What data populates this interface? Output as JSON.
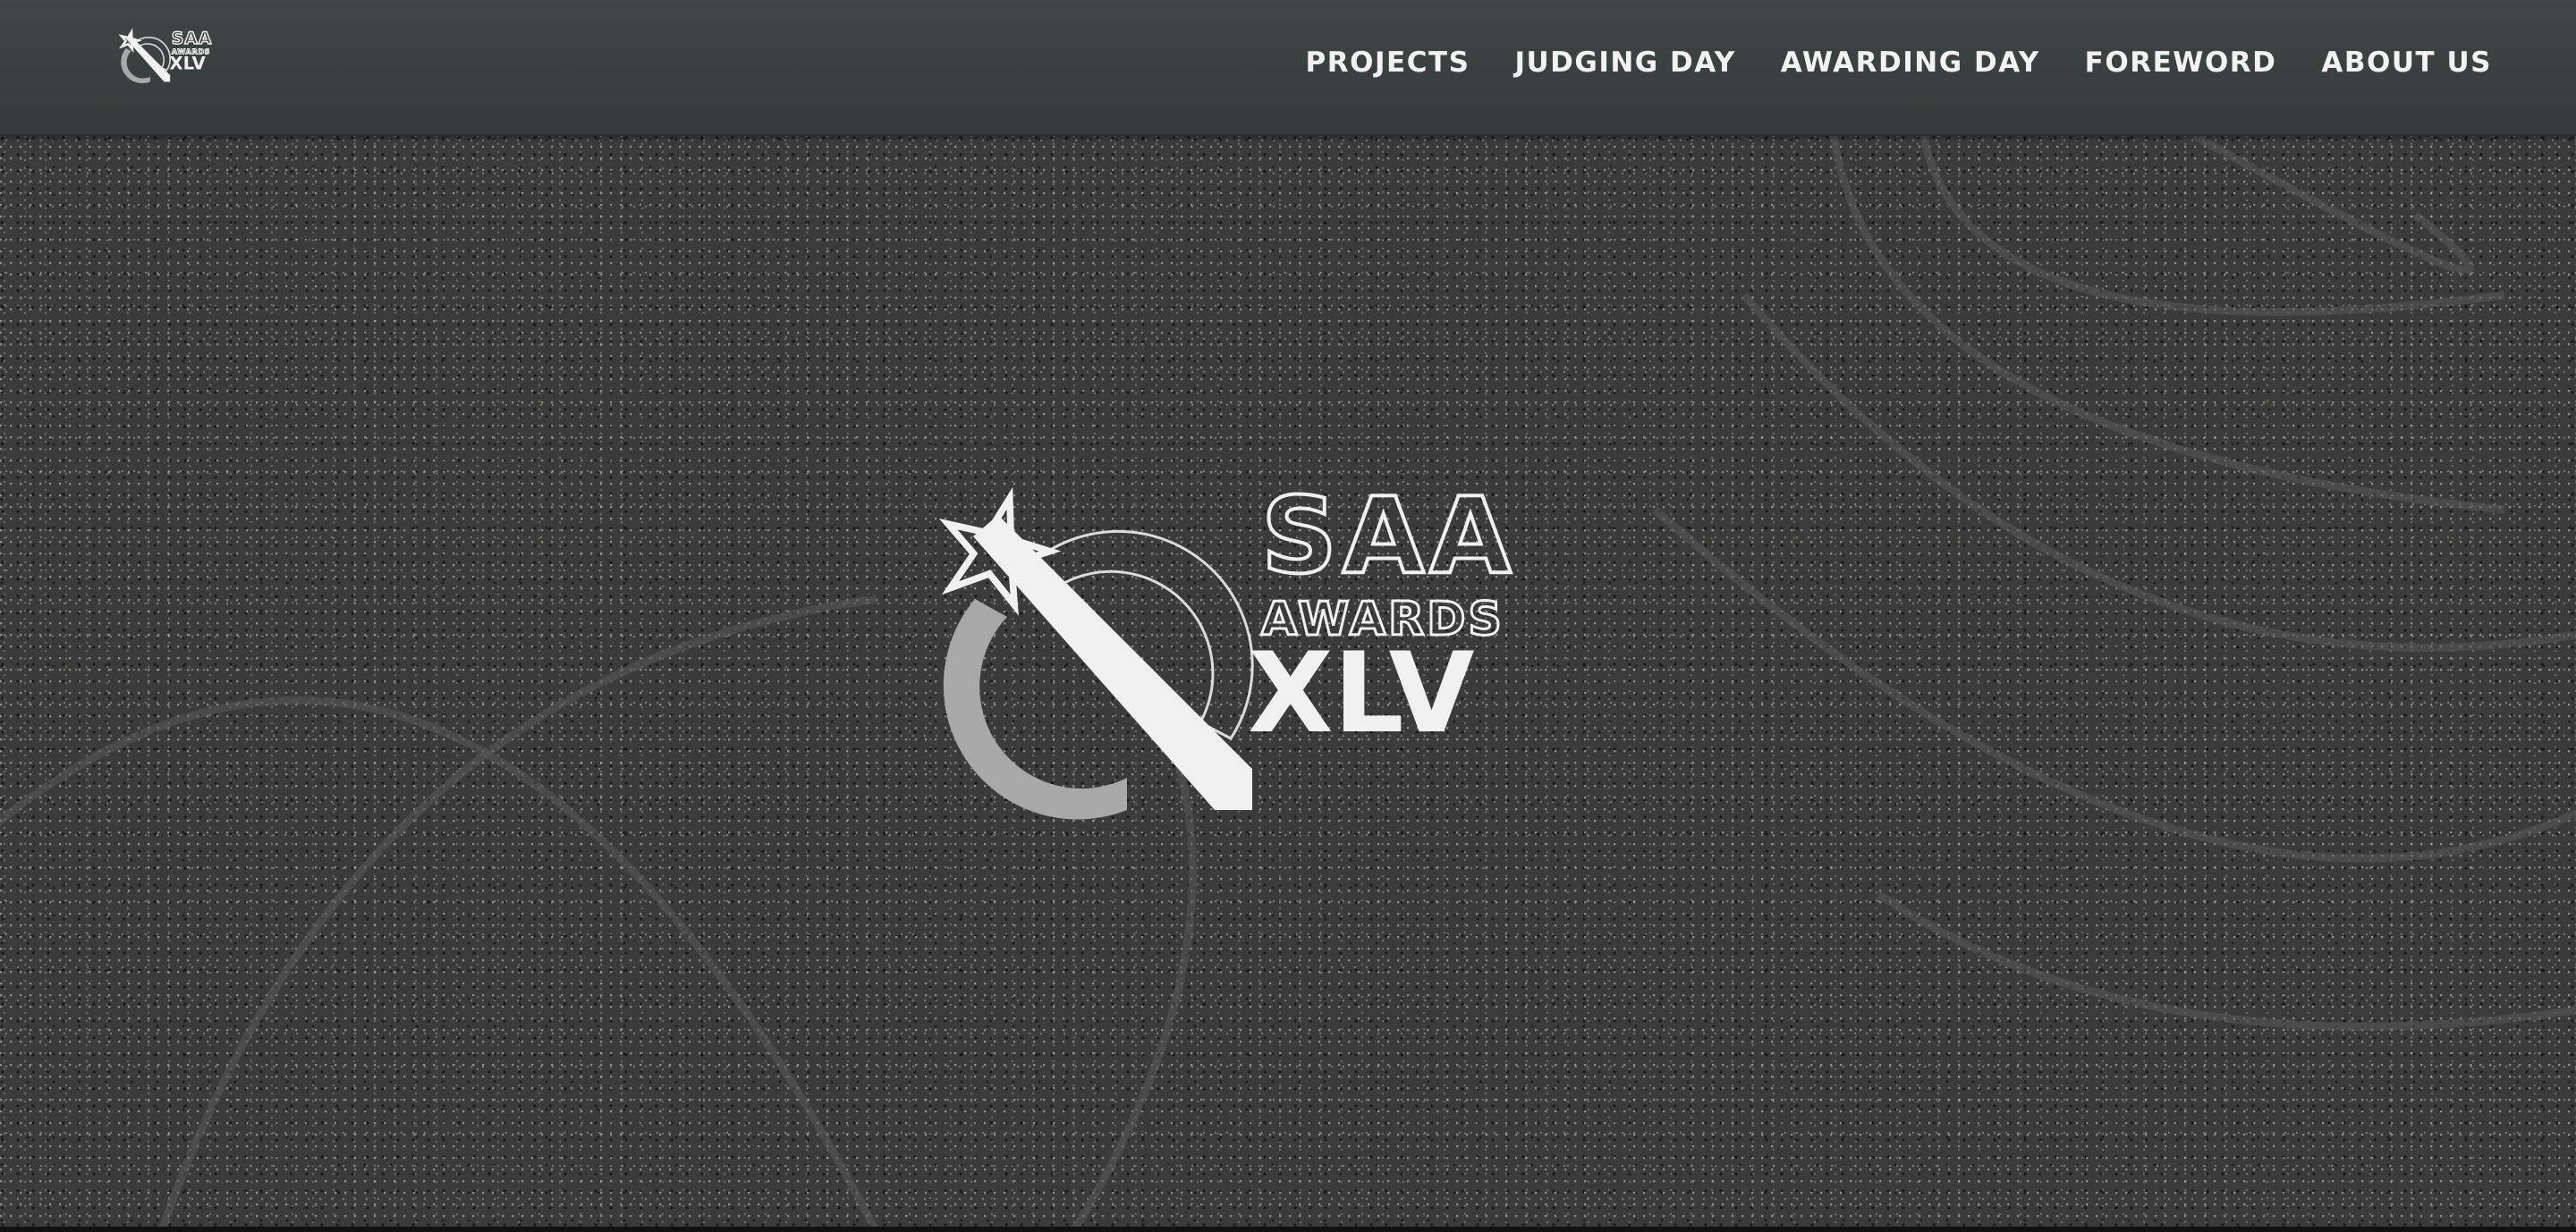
{
  "brand": {
    "line1": "SAA",
    "line2": "AWARDS",
    "line3": "XLV"
  },
  "nav": {
    "items": [
      {
        "label": "PROJECTS",
        "name": "nav-projects"
      },
      {
        "label": "JUDGING DAY",
        "name": "nav-judging-day"
      },
      {
        "label": "AWARDING DAY",
        "name": "nav-awarding-day"
      },
      {
        "label": "FOREWORD",
        "name": "nav-foreword"
      },
      {
        "label": "ABOUT US",
        "name": "nav-about-us"
      }
    ]
  },
  "colors": {
    "nav_bg": "#3d4342",
    "hero_bg": "#3b3b3b",
    "logo_light": "#f0f0f0",
    "logo_gray": "#a6a6a6",
    "nav_text": "#f2f2f2"
  }
}
